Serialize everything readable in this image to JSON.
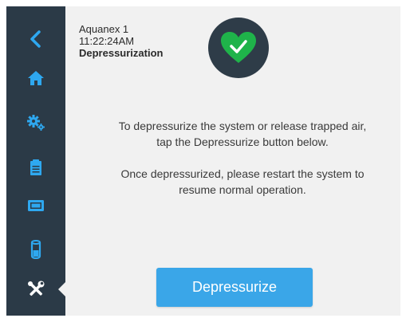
{
  "header": {
    "device_name": "Aquanex 1",
    "time": "11:22:24AM",
    "screen_title": "Depressurization"
  },
  "status": {
    "icon": "heart-check-icon",
    "color": "#1fb34a"
  },
  "sidebar": {
    "background": "#2b3a47",
    "icon_color": "#2ea8f0",
    "items": [
      {
        "name": "back",
        "icon": "chevron-left-icon",
        "active": false
      },
      {
        "name": "home",
        "icon": "home-icon",
        "active": false
      },
      {
        "name": "settings",
        "icon": "gears-icon",
        "active": false
      },
      {
        "name": "log",
        "icon": "clipboard-icon",
        "active": false
      },
      {
        "name": "display",
        "icon": "display-icon",
        "active": false
      },
      {
        "name": "tank",
        "icon": "cylinder-icon",
        "active": false
      },
      {
        "name": "tools",
        "icon": "tools-icon",
        "active": true
      }
    ]
  },
  "main": {
    "message_1": "To depressurize the system or release trapped air, tap the Depressurize button below.",
    "message_2": "Once depressurized, please restart the system to resume normal operation.",
    "button_label": "Depressurize",
    "button_color": "#3aa6e8"
  }
}
